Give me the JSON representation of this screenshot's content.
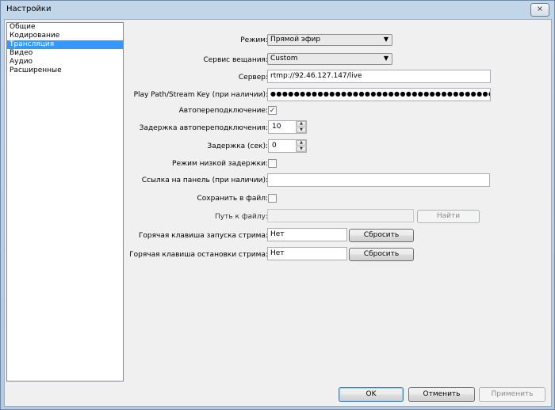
{
  "window": {
    "title": "Настройки",
    "close_glyph": "×"
  },
  "sidebar": {
    "items": [
      {
        "label": "Общие"
      },
      {
        "label": "Кодирование"
      },
      {
        "label": "Трансляция"
      },
      {
        "label": "Видео"
      },
      {
        "label": "Аудио"
      },
      {
        "label": "Расширенные"
      }
    ],
    "selected": "Трансляция"
  },
  "form": {
    "mode_label": "Режим:",
    "mode_value": "Прямой эфир",
    "service_label": "Сервис вещания:",
    "service_value": "Custom",
    "server_label": "Сервер:",
    "server_value": "rtmp://92.46.127.147/live",
    "key_label": "Play Path/Stream Key (при наличии):",
    "key_value": "●●●●●●●●●●●●●●●●●●●●●●●●●●●●●●●●●●●●●●●●●●●●●●●●●●●●●●●●●●●●●●",
    "autoreconnect_label": "Автопереподключение:",
    "autoreconnect_checked": true,
    "autoreconnect_mark": "✓",
    "reconnect_delay_label": "Задержка автопереподключения:",
    "reconnect_delay_value": "10",
    "delay_label": "Задержка (сек):",
    "delay_value": "0",
    "low_latency_label": "Режим низкой задержки:",
    "low_latency_checked": false,
    "dashboard_label": "Ссылка на панель (при наличии):",
    "dashboard_value": "",
    "save_file_label": "Сохранить в файл:",
    "save_file_checked": false,
    "file_path_label": "Путь к файлу:",
    "file_path_value": "",
    "browse_button": "Найти",
    "start_hotkey_label": "Горячая клавиша запуска стрима:",
    "start_hotkey_value": "Нет",
    "stop_hotkey_label": "Горячая клавиша остановки стрима:",
    "stop_hotkey_value": "Нет",
    "reset_label": "Сбросить",
    "dropdown_glyph": "▼",
    "spin_up_glyph": "▲",
    "spin_down_glyph": "▼"
  },
  "footer": {
    "ok": "OK",
    "cancel": "Отменить",
    "apply": "Применить"
  }
}
